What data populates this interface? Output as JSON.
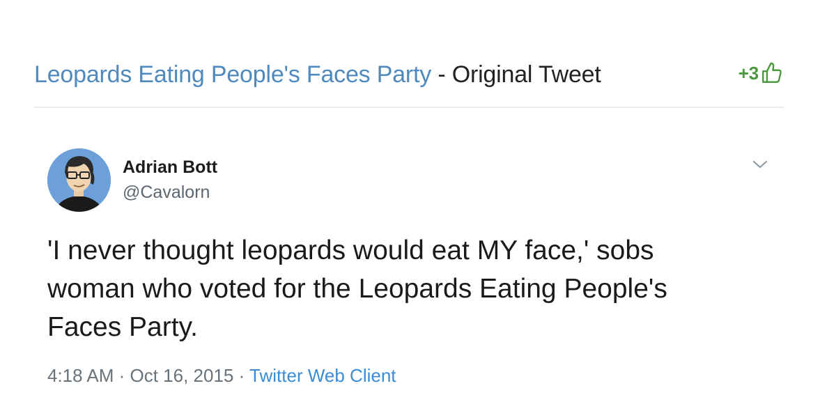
{
  "header": {
    "community_link": "Leopards Eating People's Faces Party",
    "separator": " - ",
    "title": "Original Tweet",
    "vote_count": "+3",
    "vote_icon": "thumbs-up-icon",
    "colors": {
      "link": "#4f89bd",
      "vote": "#4a9a3d"
    }
  },
  "tweet": {
    "author_name": "Adrian Bott",
    "author_handle": "@Cavalorn",
    "text": "'I never thought leopards would eat MY face,' sobs woman who voted for the Leopards Eating People's Faces Party.",
    "time": "4:18 AM",
    "dot1": " · ",
    "date": "Oct 16, 2015",
    "dot2": " · ",
    "source": "Twitter Web Client",
    "menu_icon": "chevron-down-icon",
    "colors": {
      "source_link": "#3a8cd5",
      "meta": "#68727b"
    }
  }
}
